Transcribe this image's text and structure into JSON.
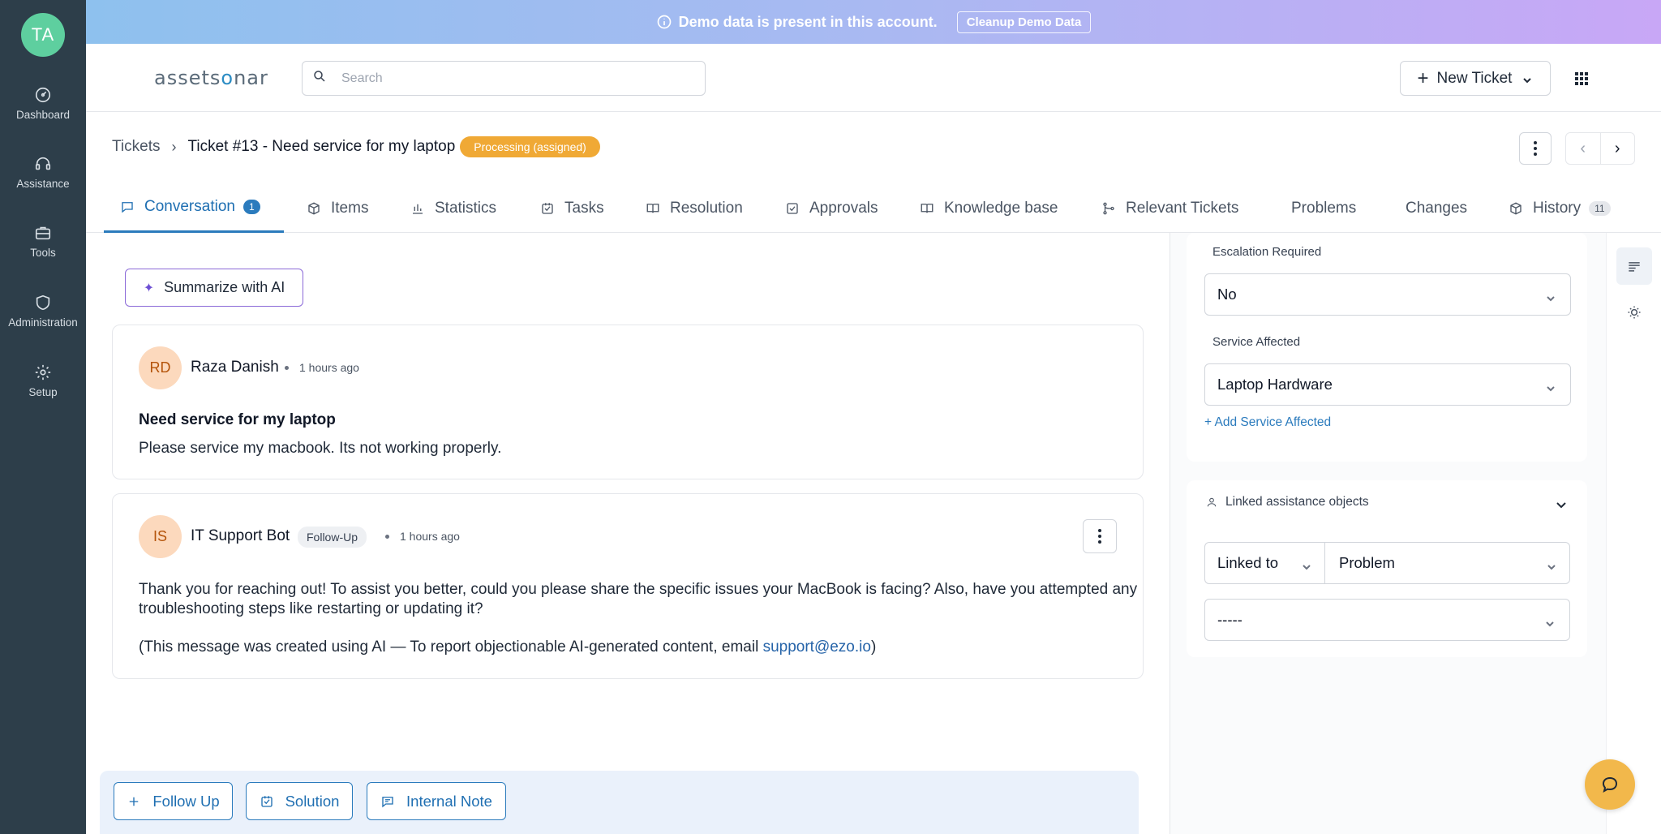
{
  "user": {
    "initials": "TA"
  },
  "sidebar": {
    "items": [
      {
        "label": "Dashboard",
        "icon": "dashboard-icon"
      },
      {
        "label": "Assistance",
        "icon": "headset-icon"
      },
      {
        "label": "Tools",
        "icon": "toolbox-icon"
      },
      {
        "label": "Administration",
        "icon": "shield-icon"
      },
      {
        "label": "Setup",
        "icon": "gear-icon"
      }
    ]
  },
  "banner": {
    "message": "Demo data is present in this account.",
    "cleanup_label": "Cleanup Demo Data"
  },
  "header": {
    "logo_left": "assets",
    "logo_o": "o",
    "logo_right": "nar",
    "search_placeholder": "Search",
    "new_ticket_label": "New Ticket"
  },
  "breadcrumb": {
    "root": "Tickets",
    "title": "Ticket #13 - Need service for my laptop",
    "status": "Processing (assigned)",
    "status_color": "#f0a935"
  },
  "tabs": [
    {
      "label": "Conversation",
      "count": "1",
      "active": true
    },
    {
      "label": "Items"
    },
    {
      "label": "Statistics"
    },
    {
      "label": "Tasks"
    },
    {
      "label": "Resolution"
    },
    {
      "label": "Approvals"
    },
    {
      "label": "Knowledge base"
    },
    {
      "label": "Relevant Tickets"
    },
    {
      "label": "Problems"
    },
    {
      "label": "Changes"
    },
    {
      "label": "History",
      "count": "11"
    }
  ],
  "conversation": {
    "summarize_label": "Summarize with AI",
    "messages": [
      {
        "initials": "RD",
        "author": "Raza Danish",
        "time": "1 hours ago",
        "title": "Need service for my laptop",
        "body": "Please service my macbook. Its not working properly."
      },
      {
        "initials": "IS",
        "author": "IT Support Bot",
        "tag": "Follow-Up",
        "time": "1 hours ago",
        "body_line1": "Thank you for reaching out! To assist you better, could you please share the specific issues your MacBook is facing? Also, have you attempted any",
        "body_line2": "troubleshooting steps like restarting or updating it?",
        "disclaimer_prefix": "(This message was created using AI — To report objectionable AI-generated content, email ",
        "disclaimer_email": "support@ezo.io",
        "disclaimer_suffix": ")"
      }
    ]
  },
  "compose": {
    "follow_up": "Follow Up",
    "solution": "Solution",
    "internal_note": "Internal Note"
  },
  "details": {
    "escalation_label": "Escalation Required",
    "escalation_value": "No",
    "service_label": "Service Affected",
    "service_value": "Laptop Hardware",
    "add_service_label": "+ Add Service Affected"
  },
  "linked": {
    "title": "Linked assistance objects",
    "linked_to_label": "Linked to",
    "linked_type": "Problem",
    "linked_value": "-----"
  },
  "colors": {
    "sidebar": "#2d3e4a",
    "accent": "#2b7bbd",
    "fab": "#f2b84b"
  }
}
